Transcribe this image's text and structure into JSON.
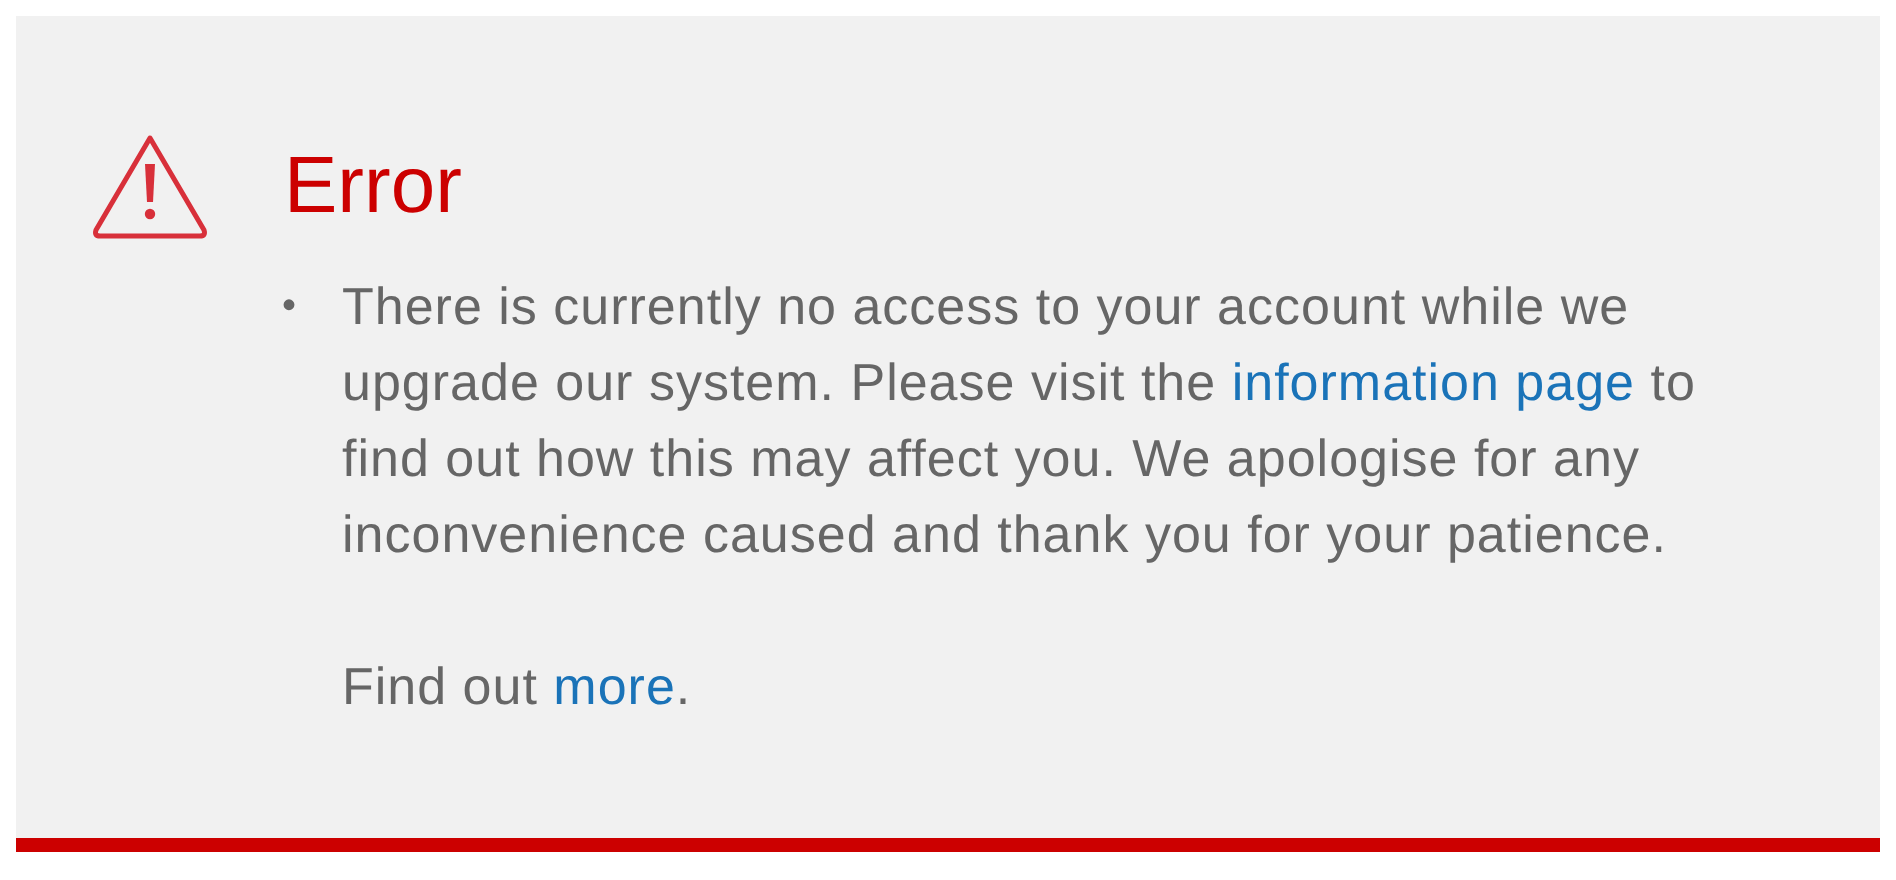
{
  "alert": {
    "title": "Error",
    "items": [
      {
        "marker": "•",
        "parts": [
          {
            "kind": "text",
            "text": "There is currently no access to your account while we upgrade our system. Please visit the "
          },
          {
            "kind": "link",
            "text": "information page"
          },
          {
            "kind": "text",
            "text": " to find out how this may affect you. We apologise for any inconvenience caused and thank you for your patience."
          }
        ]
      }
    ],
    "footer": [
      {
        "kind": "text",
        "text": "Find out "
      },
      {
        "kind": "link",
        "text": "more"
      },
      {
        "kind": "text",
        "text": "."
      }
    ]
  }
}
